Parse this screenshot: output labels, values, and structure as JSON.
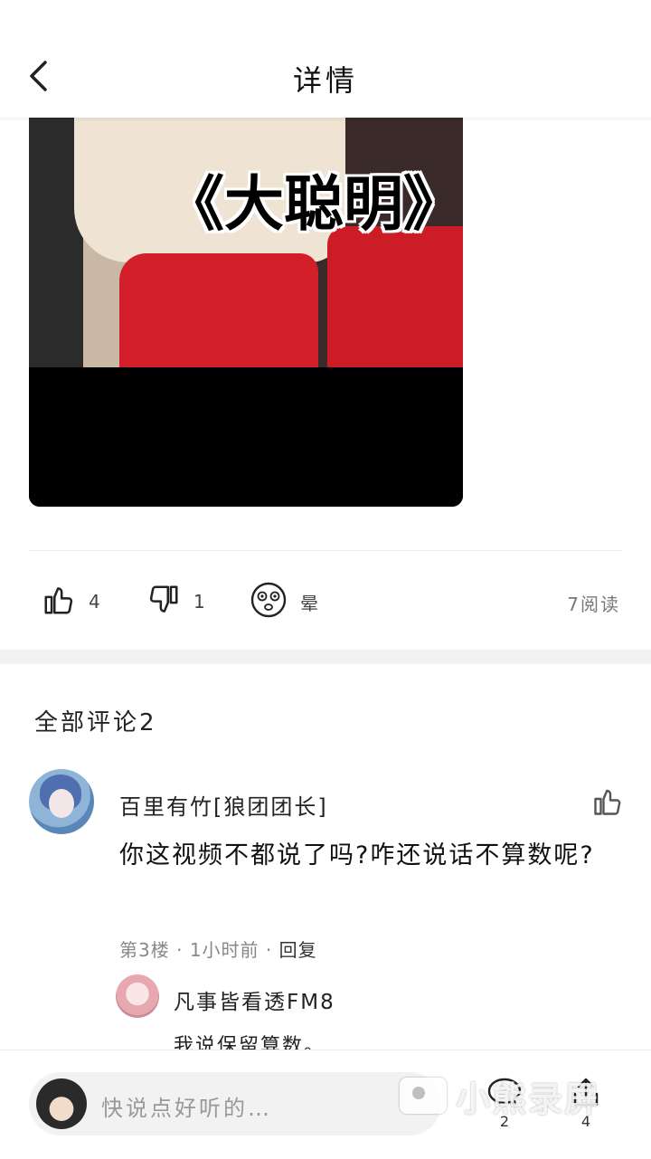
{
  "header": {
    "title": "详情",
    "back_icon": "chevron-left-icon"
  },
  "media": {
    "overlay_text": "《大聪明》"
  },
  "actions": {
    "like": {
      "icon": "thumbs-up-icon",
      "count": "4"
    },
    "dislike": {
      "icon": "thumbs-down-icon",
      "count": "1"
    },
    "dizzy": {
      "icon": "dizzy-face-icon",
      "label": "晕"
    },
    "read_count": "7阅读"
  },
  "comments": {
    "title": "全部评论2",
    "items": [
      {
        "author": "百里有竹[狼团团长]",
        "text": "你这视频不都说了吗?咋还说话不算数呢?",
        "floor": "第3楼",
        "time": "1小时前",
        "reply_label": "回复",
        "like_icon": "thumbs-up-icon",
        "reply": {
          "author": "凡事皆看透FM8",
          "text": "我说保留算数。"
        }
      }
    ]
  },
  "bottom_bar": {
    "placeholder": "快说点好听的…",
    "comment_count": "2",
    "share_count": "4",
    "comment_icon": "comment-bubble-icon",
    "share_icon": "share-icon"
  },
  "watermark": {
    "text": "小熊录屏"
  }
}
